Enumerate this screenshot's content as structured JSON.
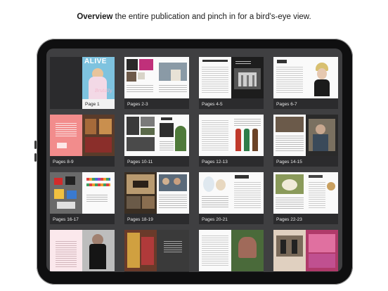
{
  "caption": {
    "bold": "Overview",
    "rest": " the entire publication and pinch in for a bird's-eye view."
  },
  "cover": {
    "masthead": "ALIVE",
    "script": "Brutally"
  },
  "tiles": [
    {
      "label": "Page 1"
    },
    {
      "label": "Pages 2-3"
    },
    {
      "label": "Pages 4-5"
    },
    {
      "label": "Pages 6-7"
    },
    {
      "label": "Pages 8-9"
    },
    {
      "label": "Pages 10-11"
    },
    {
      "label": "Pages 12-13"
    },
    {
      "label": "Pages 14-15"
    },
    {
      "label": "Pages 16-17"
    },
    {
      "label": "Pages 18-19"
    },
    {
      "label": "Pages 20-21"
    },
    {
      "label": "Pages 22-23"
    }
  ],
  "colors": {
    "cover_bg": "#7ec3df",
    "screen_bg": "#3f3f41",
    "device": "#0f0f10"
  }
}
